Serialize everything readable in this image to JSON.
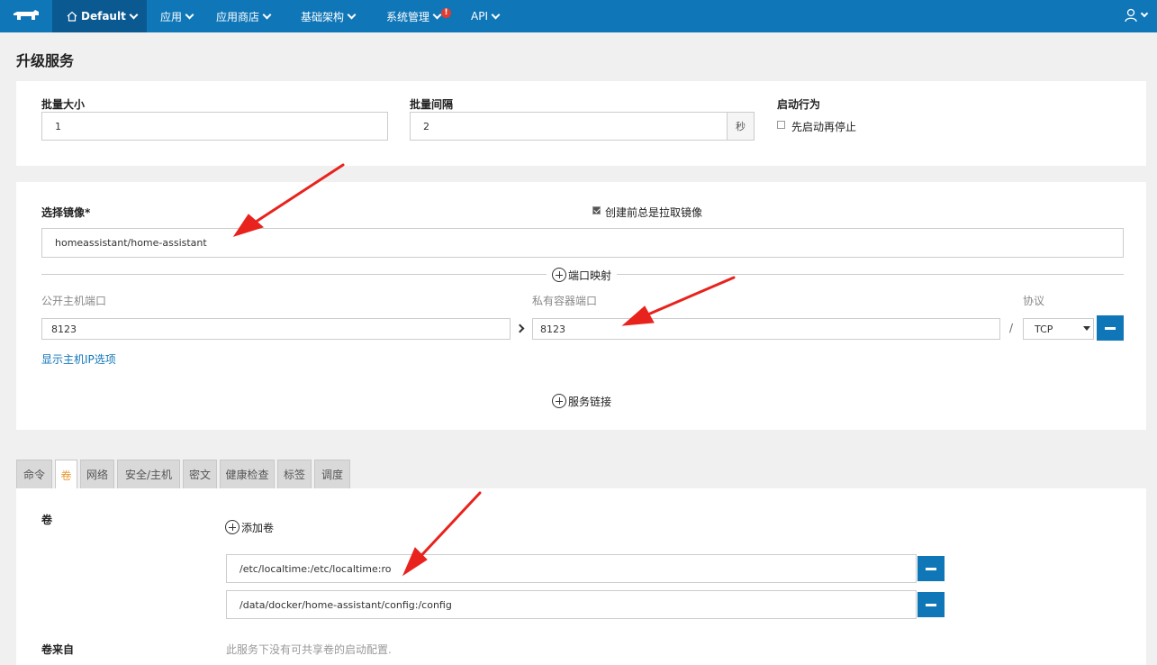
{
  "nav": {
    "env_label": "Default",
    "items": [
      "应用",
      "应用商店",
      "基础架构",
      "系统管理",
      "API"
    ],
    "alert_mark": "!"
  },
  "page_title": "升级服务",
  "upgrade": {
    "batch_size_label": "批量大小",
    "batch_size_value": "1",
    "batch_interval_label": "批量间隔",
    "batch_interval_value": "2",
    "interval_unit": "秒",
    "start_behavior_label": "启动行为",
    "start_first_label": "先启动再停止"
  },
  "image": {
    "label": "选择镜像*",
    "value": "homeassistant/home-assistant",
    "always_pull_label": "创建前总是拉取镜像"
  },
  "ports": {
    "section_label": "端口映射",
    "public_label": "公开主机端口",
    "private_label": "私有容器端口",
    "protocol_label": "协议",
    "public_value": "8123",
    "private_value": "8123",
    "slash": "/",
    "protocol_value": "TCP",
    "show_ip_link": "显示主机IP选项"
  },
  "service_links": {
    "label": "服务链接"
  },
  "tabs": [
    "命令",
    "卷",
    "网络",
    "安全/主机",
    "密文",
    "健康检查",
    "标签",
    "调度"
  ],
  "volumes": {
    "label": "卷",
    "add_label": "添加卷",
    "entries": [
      "/etc/localtime:/etc/localtime:ro",
      "/data/docker/home-assistant/config:/config"
    ],
    "from_label": "卷来自",
    "from_note": "此服务下没有可共享卷的启动配置."
  },
  "colors": {
    "nav": "#0f76b8",
    "nav_active": "#0a5a91",
    "arrow": "#e8231d",
    "active_tab": "#e79a30"
  }
}
